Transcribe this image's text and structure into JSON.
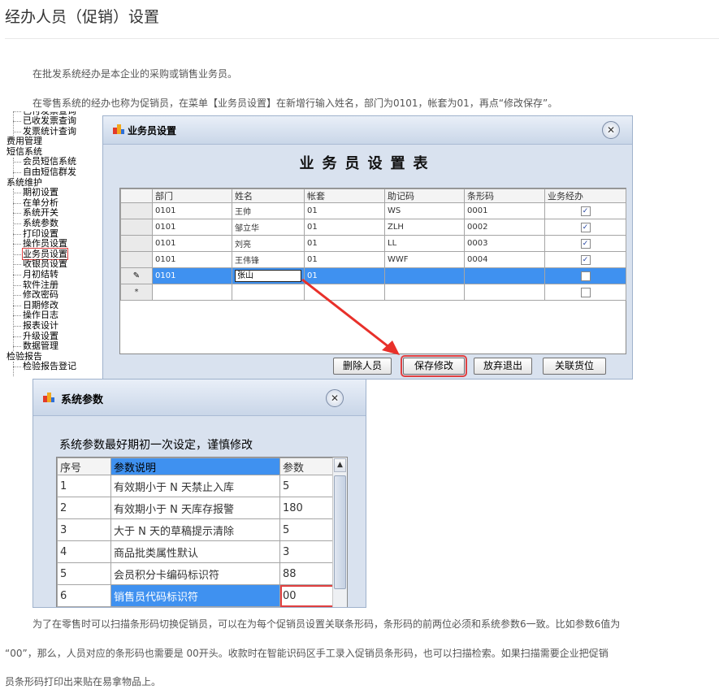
{
  "page": {
    "title": "经办人员（促销）设置",
    "paragraph1": "在批发系统经办是本企业的采购或销售业务员。",
    "paragraph2": "在零售系统的经办也称为促销员，在菜单【业务员设置】在新增行输入姓名，部门为0101，帐套为01，再点“修改保存”。",
    "bottom_line1": "为了在零售时可以扫描条形码切换促销员，可以在为每个促销员设置关联条形码，条形码的前两位必须和系统参数6一致。比如参数6值为",
    "bottom_line2": "“00”，那么，人员对应的条形码也需要是 00开头。收款时在智能识码区手工录入促销员条形码，也可以扫描检索。如果扫描需要企业把促销",
    "bottom_line3": "员条形码打印出来贴在易拿物品上。"
  },
  "tree": {
    "items": [
      {
        "label": "已收发票查询",
        "level": 2
      },
      {
        "label": "发票统计查询",
        "level": 2
      },
      {
        "label": "费用管理",
        "level": 1
      },
      {
        "label": "短信系统",
        "level": 1
      },
      {
        "label": "会员短信系统",
        "level": 2
      },
      {
        "label": "自由短信群发",
        "level": 2
      },
      {
        "label": "系统维护",
        "level": 1
      },
      {
        "label": "期初设置",
        "level": 2
      },
      {
        "label": "在单分析",
        "level": 2
      },
      {
        "label": "系统开关",
        "level": 2
      },
      {
        "label": "系统参数",
        "level": 2
      },
      {
        "label": "打印设置",
        "level": 2
      },
      {
        "label": "操作员设置",
        "level": 2
      },
      {
        "label": "业务员设置",
        "level": 2
      },
      {
        "label": "收银员设置",
        "level": 2
      },
      {
        "label": "月初结转",
        "level": 2
      },
      {
        "label": "软件注册",
        "level": 2
      },
      {
        "label": "修改密码",
        "level": 2
      },
      {
        "label": "日期修改",
        "level": 2
      },
      {
        "label": "操作日志",
        "level": 2
      },
      {
        "label": "报表设计",
        "level": 2
      },
      {
        "label": "升级设置",
        "level": 2
      },
      {
        "label": "数据管理",
        "level": 2
      },
      {
        "label": "检验报告",
        "level": 1
      },
      {
        "label": "检验报告登记",
        "level": 2
      }
    ],
    "highlighted": "业务员设置"
  },
  "salesman_dialog": {
    "title": "业务员设置",
    "heading": "业务员设置表",
    "columns": [
      "部门",
      "姓名",
      "帐套",
      "助记码",
      "条形码",
      "业务经办"
    ],
    "rows": [
      {
        "dept": "0101",
        "name": "王帅",
        "account": "01",
        "code": "WS",
        "barcode": "0001",
        "checked": true
      },
      {
        "dept": "0101",
        "name": "邹立华",
        "account": "01",
        "code": "ZLH",
        "barcode": "0002",
        "checked": true
      },
      {
        "dept": "0101",
        "name": "刘亮",
        "account": "01",
        "code": "LL",
        "barcode": "0003",
        "checked": true
      },
      {
        "dept": "0101",
        "name": "王伟锋",
        "account": "01",
        "code": "WWF",
        "barcode": "0004",
        "checked": true
      },
      {
        "dept": "0101",
        "name": "张山",
        "account": "01",
        "code": "",
        "barcode": "",
        "checked": false
      }
    ],
    "edit_indicator": "✎",
    "new_row_indicator": "*",
    "buttons": {
      "delete": "删除人员",
      "save": "保存修改",
      "cancel": "放弃退出",
      "link": "关联货位"
    }
  },
  "params_dialog": {
    "title": "系统参数",
    "note": "系统参数最好期初一次设定，谨慎修改",
    "columns": [
      "序号",
      "参数说明",
      "参数"
    ],
    "rows": [
      {
        "no": "1",
        "desc": "有效期小于 N 天禁止入库",
        "value": "5"
      },
      {
        "no": "2",
        "desc": "有效期小于 N 天库存报警",
        "value": "180"
      },
      {
        "no": "3",
        "desc": "大于 N 天的草稿提示清除",
        "value": "5"
      },
      {
        "no": "4",
        "desc": "商品批类属性默认",
        "value": "3"
      },
      {
        "no": "5",
        "desc": "会员积分卡编码标识符",
        "value": "88"
      },
      {
        "no": "6",
        "desc": "销售员代码标识符",
        "value": "00"
      }
    ]
  },
  "colors": {
    "selection": "#3f91f0",
    "dialog_bg": "#d9e2ef",
    "highlight_red": "#e04040"
  }
}
